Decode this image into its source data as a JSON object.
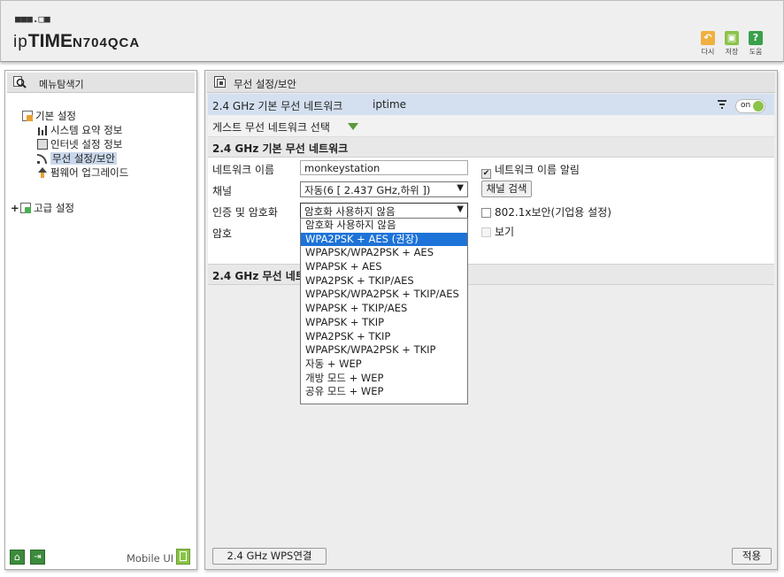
{
  "header": {
    "logo_dots": "■■■.□■",
    "brand_prefix": "ip",
    "brand_main": "TIME",
    "model": "N704QCA",
    "buttons": [
      {
        "label": "다시",
        "icon": "undo-icon",
        "color": "#f0b040"
      },
      {
        "label": "저장",
        "icon": "save-icon",
        "color": "#8bc34a"
      },
      {
        "label": "도움",
        "icon": "help-icon",
        "color": "#3aa04a"
      }
    ]
  },
  "left": {
    "title": "메뉴탐색기",
    "tree": [
      {
        "label": "기본 설정",
        "level": 0
      },
      {
        "label": "시스템 요약 정보",
        "level": 1
      },
      {
        "label": "인터넷 설정 정보",
        "level": 1
      },
      {
        "label": "무선 설정/보안",
        "level": 1,
        "selected": true
      },
      {
        "label": "펌웨어 업그레이드",
        "level": 1
      }
    ],
    "advanced": "고급 설정",
    "advanced_expander": "+",
    "mobile_ui": "Mobile UI"
  },
  "right": {
    "title": "무선 설정/보안",
    "network_bar": {
      "label": "2.4 GHz 기본 무선 네트워크",
      "ssid": "iptime",
      "toggle": "on"
    },
    "guest_label": "게스트 무선 네트워크 선택",
    "section_title": "2.4 GHz 기본 무선 네트워크",
    "network_name_label": "네트워크 이름",
    "network_name_value": "monkeystation",
    "broadcast_label": "네트워크 이름 알림",
    "channel_label": "채널",
    "channel_value": "자동(6 [ 2.437 GHz,하위 ])",
    "channel_scan": "채널 검색",
    "auth_label": "인증 및 암호화",
    "auth_value": "암호화 사용하지 않음",
    "dot1x_label": "802.1x보안(기업용 설정)",
    "password_label": "암호",
    "show_label": "보기",
    "section2_title": "2.4 GHz 무선 네트",
    "auth_options": [
      "암호화 사용하지 않음",
      "WPA2PSK + AES (권장)",
      "WPAPSK/WPA2PSK + AES",
      "WPAPSK + AES",
      "WPA2PSK + TKIP/AES",
      "WPAPSK/WPA2PSK + TKIP/AES",
      "WPAPSK + TKIP/AES",
      "WPAPSK + TKIP",
      "WPA2PSK + TKIP",
      "WPAPSK/WPA2PSK + TKIP",
      "자동 + WEP",
      "개방 모드 + WEP",
      "공유 모드 + WEP"
    ],
    "highlighted_option": 1,
    "wps_button": "2.4 GHz WPS연결",
    "apply_button": "적용"
  }
}
